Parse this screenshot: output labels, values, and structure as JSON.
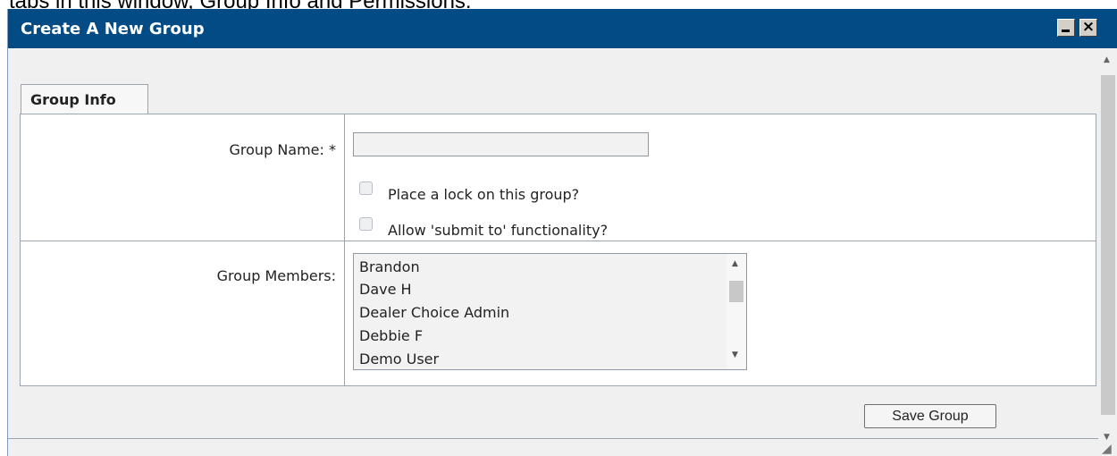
{
  "caption": "tabs in this window, Group Info and Permissions.",
  "window": {
    "title": "Create A New Group",
    "close_glyph": "×"
  },
  "tabs": [
    {
      "label": "Group Info",
      "active": true
    }
  ],
  "form": {
    "group_name_label": "Group Name: *",
    "group_name_value": "",
    "lock_label": "Place a lock on this group?",
    "lock_checked": false,
    "submit_to_label": "Allow 'submit to' functionality?",
    "submit_to_checked": false,
    "members_label": "Group Members:",
    "members": [
      "Brandon",
      "Dave H",
      "Dealer Choice Admin",
      "Debbie F",
      "Demo User"
    ]
  },
  "save_button": "Save Group",
  "icons": {
    "scroll_up": "▲",
    "scroll_down": "▼",
    "resize_grip": "◢"
  }
}
